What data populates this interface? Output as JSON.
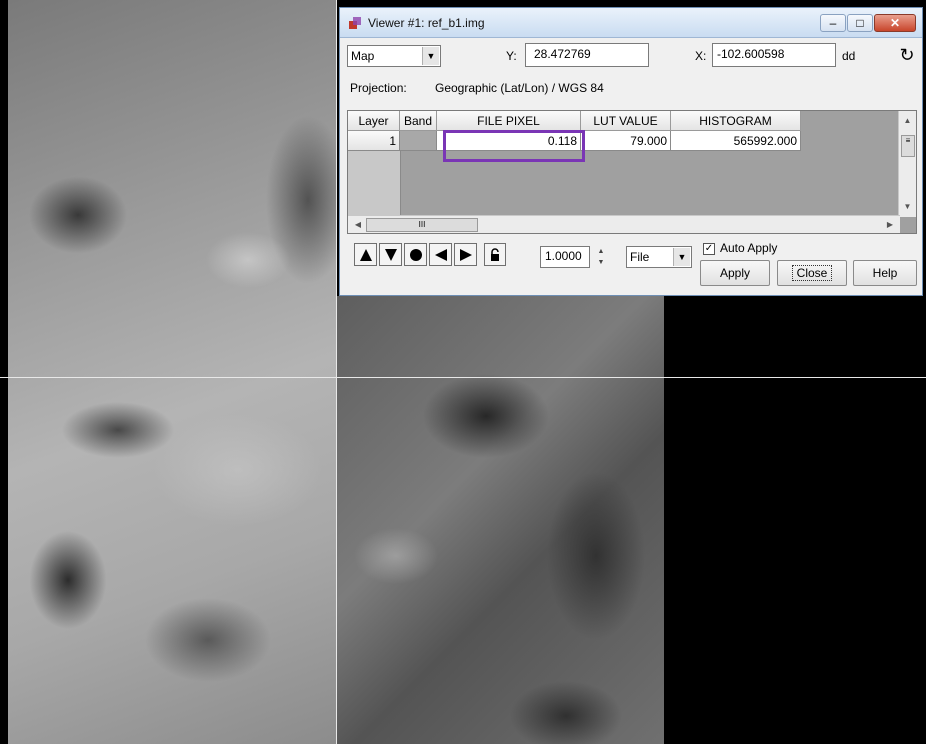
{
  "window": {
    "title": "Viewer #1:  ref_b1.img",
    "min_glyph": "–",
    "max_glyph": "□",
    "close_glyph": "✕"
  },
  "coords": {
    "system": "Map",
    "y_label": "Y:",
    "y_value": "28.472769",
    "x_label": "X:",
    "x_value": "-102.600598",
    "units": "dd",
    "refresh_glyph": "↻"
  },
  "projection": {
    "label": "Projection:",
    "value": "Geographic (Lat/Lon) / WGS 84"
  },
  "table": {
    "columns": [
      "Layer",
      "Band",
      "FILE PIXEL",
      "LUT VALUE",
      "HISTOGRAM"
    ],
    "rows": [
      {
        "layer": "1",
        "band": "",
        "file_pixel": "0.118",
        "lut_value": "79.000",
        "histogram": "565992.000"
      }
    ],
    "highlight_color": "#7a35b5"
  },
  "toolbar": {
    "zoom": "1.0000",
    "file_mode": "File",
    "auto_apply_label": "Auto Apply",
    "auto_apply_checked": true,
    "check_glyph": "✓",
    "apply_label": "Apply",
    "close_label": "Close",
    "help_label": "Help"
  },
  "icons": {
    "up": "up-triangle-icon",
    "down": "down-triangle-icon",
    "dot": "circle-icon",
    "left": "left-triangle-icon",
    "right": "right-triangle-icon",
    "lock": "lock-icon",
    "dropdown": "▼",
    "spin_up": "▲",
    "spin_down": "▼",
    "scroll_up": "▲",
    "scroll_down": "▼",
    "scroll_left": "◀",
    "scroll_right": "▶",
    "grip_h": "III",
    "grip_v": "≡"
  }
}
